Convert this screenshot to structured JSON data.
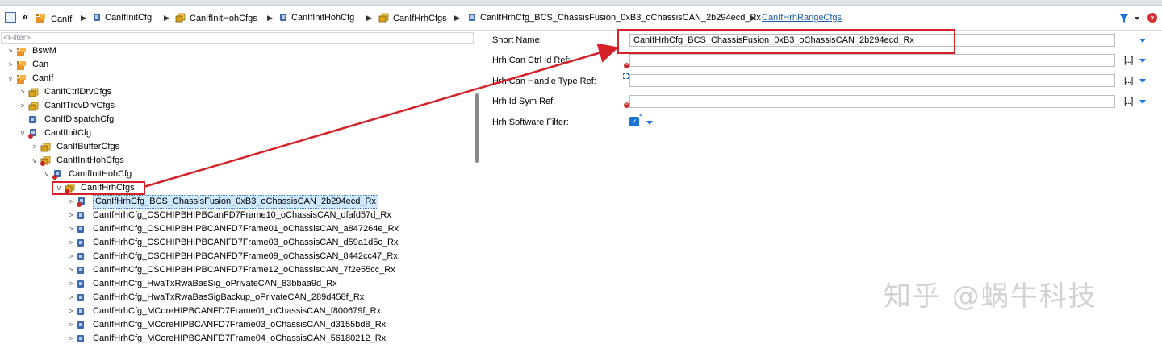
{
  "breadcrumb": {
    "items": [
      {
        "label": "CanIf",
        "icon": "module-icon"
      },
      {
        "label": "CanIfInitCfg",
        "icon": "container-icon"
      },
      {
        "label": "CanIfInitHohCfgs",
        "icon": "container-list-icon"
      },
      {
        "label": "CanIfInitHohCfg",
        "icon": "container-icon"
      },
      {
        "label": "CanIfHrhCfgs",
        "icon": "container-list-icon"
      },
      {
        "label": "CanIfHrhCfg_BCS_ChassisFusion_0xB3_oChassisCAN_2b294ecd_Rx",
        "icon": "container-icon"
      }
    ],
    "link": "CanIfHrhRangeCfgs"
  },
  "tree": {
    "filter_placeholder": "<Filter>",
    "nodes": [
      {
        "label": "BswM",
        "icon": "module-icon",
        "expander": ">"
      },
      {
        "label": "Can",
        "icon": "module-icon",
        "expander": ">"
      },
      {
        "label": "CanIf",
        "icon": "module-icon",
        "expander": "v"
      },
      {
        "label": "CanIfCtrlDrvCfgs",
        "icon": "container-list-icon",
        "expander": ">"
      },
      {
        "label": "CanIfTrcvDrvCfgs",
        "icon": "container-list-icon",
        "expander": ">"
      },
      {
        "label": "CanIfDispatchCfg",
        "icon": "container-icon",
        "expander": ""
      },
      {
        "label": "CanIfInitCfg",
        "icon": "container-error-icon",
        "expander": "v"
      },
      {
        "label": "CanIfBufferCfgs",
        "icon": "container-list-icon",
        "expander": ">"
      },
      {
        "label": "CanIfInitHohCfgs",
        "icon": "container-list-error-icon",
        "expander": "v"
      },
      {
        "label": "CanIfInitHohCfg",
        "icon": "container-error-icon",
        "expander": "v"
      },
      {
        "label": "CanIfHrhCfgs",
        "icon": "container-list-error-icon",
        "expander": "v"
      },
      {
        "label": "CanIfHrhCfg_BCS_ChassisFusion_0xB3_oChassisCAN_2b294ecd_Rx",
        "icon": "container-error-icon",
        "expander": ">"
      },
      {
        "label": "CanIfHrhCfg_CSCHIPBHIPBCanFD7Frame10_oChassisCAN_dfafd57d_Rx",
        "icon": "container-icon",
        "expander": ">"
      },
      {
        "label": "CanIfHrhCfg_CSCHIPBHIPBCANFD7Frame01_oChassisCAN_a847264e_Rx",
        "icon": "container-icon",
        "expander": ">"
      },
      {
        "label": "CanIfHrhCfg_CSCHIPBHIPBCANFD7Frame03_oChassisCAN_d59a1d5c_Rx",
        "icon": "container-icon",
        "expander": ">"
      },
      {
        "label": "CanIfHrhCfg_CSCHIPBHIPBCANFD7Frame09_oChassisCAN_8442cc47_Rx",
        "icon": "container-icon",
        "expander": ">"
      },
      {
        "label": "CanIfHrhCfg_CSCHIPBHIPBCANFD7Frame12_oChassisCAN_7f2e55cc_Rx",
        "icon": "container-icon",
        "expander": ">"
      },
      {
        "label": "CanIfHrhCfg_HwaTxRwaBasSig_oPrivateCAN_83bbaa9d_Rx",
        "icon": "container-icon",
        "expander": ">"
      },
      {
        "label": "CanIfHrhCfg_HwaTxRwaBasSigBackup_oPrivateCAN_289d458f_Rx",
        "icon": "container-icon",
        "expander": ">"
      },
      {
        "label": "CanIfHrhCfg_MCoreHIPBCANFD7Frame01_oChassisCAN_f800679f_Rx",
        "icon": "container-icon",
        "expander": ">"
      },
      {
        "label": "CanIfHrhCfg_MCoreHIPBCANFD7Frame03_oChassisCAN_d3155bd8_Rx",
        "icon": "container-icon",
        "expander": ">"
      },
      {
        "label": "CanIfHrhCfg_MCoreHIPBCANFD7Frame04_oChassisCAN_56180212_Rx",
        "icon": "container-icon",
        "expander": ">"
      }
    ]
  },
  "form": {
    "short_name_label": "Short Name:",
    "short_name_value": "CanIfHrhCfg_BCS_ChassisFusion_0xB3_oChassisCAN_2b294ecd_Rx",
    "hrh_can_ctrl_id_ref_label": "Hrh Can Ctrl Id Ref:",
    "hrh_can_handle_type_ref_label": "Hrh Can Handle Type Ref:",
    "hrh_id_sym_ref_label": "Hrh Id Sym Ref:",
    "hrh_software_filter_label": "Hrh Software Filter:",
    "browse_label": "[...]"
  },
  "watermark": "知乎 @蜗牛科技",
  "colors": {
    "accent": "#1a73d9",
    "highlight_red": "#d3222a",
    "selection": "#cde8ff",
    "link": "#1d5ea8",
    "module_orange": "#e8902a",
    "container_gold": "#d8a21a",
    "container_blue": "#3e6bb0"
  }
}
